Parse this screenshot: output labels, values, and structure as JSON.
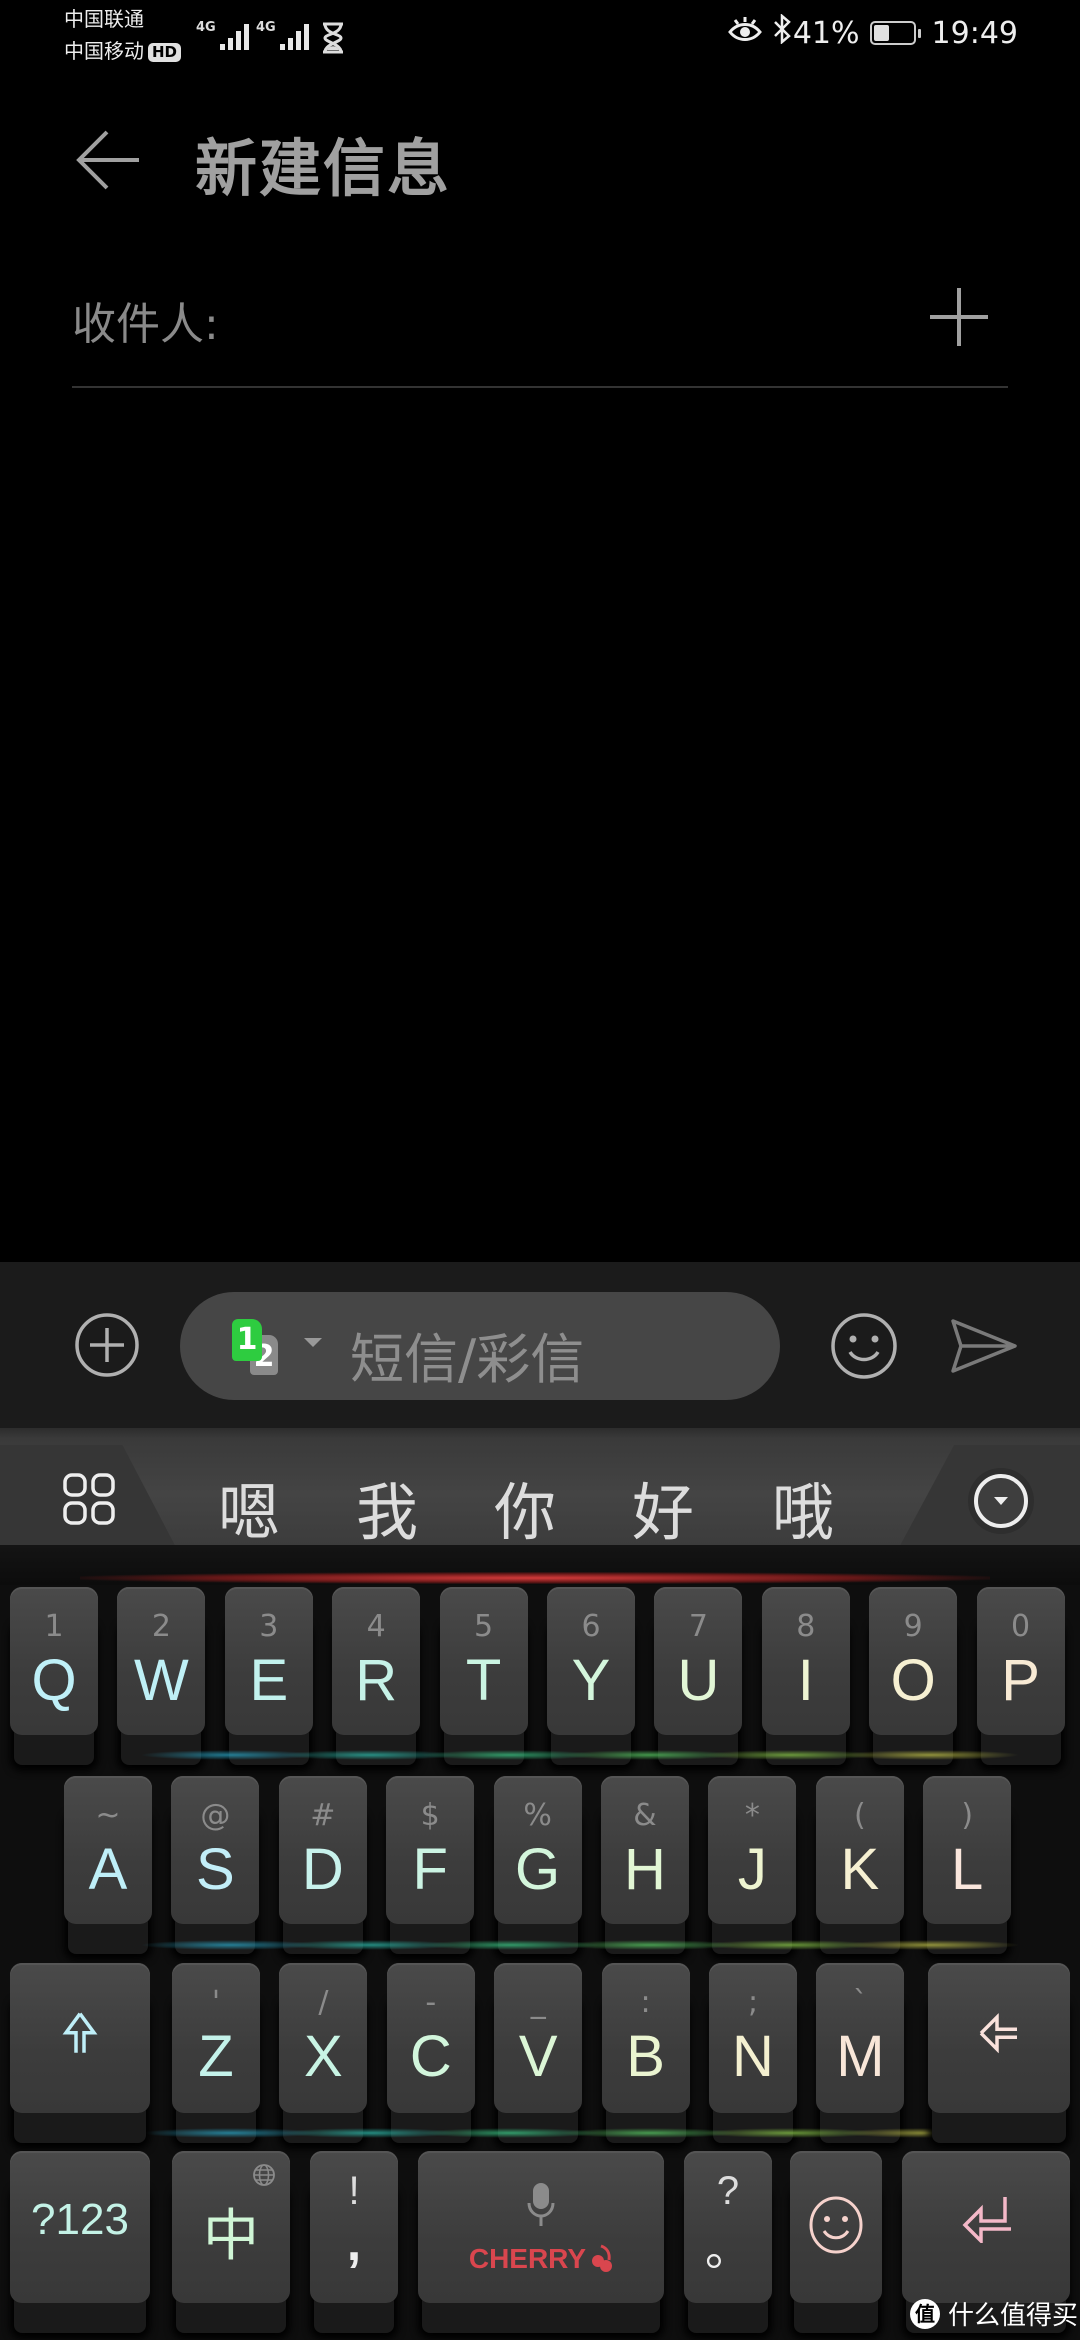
{
  "status_bar": {
    "carrier_1": "中国联通",
    "carrier_2": "中国移动",
    "hd_badge": "HD",
    "network_1": "4G",
    "network_2": "4G",
    "battery_percent": "41%",
    "battery_level": 0.41,
    "time": "19:49",
    "icons": [
      "signal-icon",
      "signal-icon",
      "hourglass-icon",
      "eye-comfort-icon",
      "bluetooth-icon",
      "battery-icon"
    ]
  },
  "header": {
    "back_icon": "arrow-left-icon",
    "title": "新建信息"
  },
  "recipient": {
    "label": "收件人:",
    "add_icon": "plus-icon"
  },
  "compose": {
    "attach_icon": "plus-circle-icon",
    "sim_card_1": "1",
    "sim_card_2": "2",
    "sim_color": "#2ecc40",
    "placeholder": "短信/彩信",
    "emoji_icon": "smiley-icon",
    "send_icon": "send-icon"
  },
  "keyboard": {
    "menu_icon": "grid-icon",
    "candidates": [
      "嗯",
      "我",
      "你",
      "好",
      "哦"
    ],
    "collapse_icon": "chevron-down-circle-icon",
    "row1": [
      {
        "main": "Q",
        "sub": "1",
        "color": "#bff0f8"
      },
      {
        "main": "W",
        "sub": "2",
        "color": "#bff0f6"
      },
      {
        "main": "E",
        "sub": "3",
        "color": "#c2f2ee"
      },
      {
        "main": "R",
        "sub": "4",
        "color": "#c6f2e8"
      },
      {
        "main": "T",
        "sub": "5",
        "color": "#caf4e2"
      },
      {
        "main": "Y",
        "sub": "6",
        "color": "#d4f6dc"
      },
      {
        "main": "U",
        "sub": "7",
        "color": "#e2f6d6"
      },
      {
        "main": "I",
        "sub": "8",
        "color": "#eef4d2"
      },
      {
        "main": "O",
        "sub": "9",
        "color": "#f6f0d2"
      },
      {
        "main": "P",
        "sub": "0",
        "color": "#f8ead4"
      }
    ],
    "row2": [
      {
        "main": "A",
        "sub": "~",
        "color": "#bfeff8"
      },
      {
        "main": "S",
        "sub": "@",
        "color": "#c2eef8"
      },
      {
        "main": "D",
        "sub": "#",
        "color": "#c8f2ec"
      },
      {
        "main": "F",
        "sub": "$",
        "color": "#ccf4e4"
      },
      {
        "main": "G",
        "sub": "%",
        "color": "#d4f6dc"
      },
      {
        "main": "H",
        "sub": "&",
        "color": "#e2f6d4"
      },
      {
        "main": "J",
        "sub": "*",
        "color": "#eef4d0"
      },
      {
        "main": "K",
        "sub": "(",
        "color": "#f6f0d2"
      },
      {
        "main": "L",
        "sub": ")",
        "color": "#fae6dc"
      }
    ],
    "row3": [
      {
        "main": "Z",
        "sub": "'",
        "color": "#c4f2ea"
      },
      {
        "main": "X",
        "sub": "/",
        "color": "#c8f4e4"
      },
      {
        "main": "C",
        "sub": "-",
        "color": "#d2f6dc"
      },
      {
        "main": "V",
        "sub": "_",
        "color": "#dcf6d6"
      },
      {
        "main": "B",
        "sub": ":",
        "color": "#eaf4d0"
      },
      {
        "main": "N",
        "sub": ";",
        "color": "#f4f0d0"
      },
      {
        "main": "M",
        "sub": "`",
        "color": "#f8e6d8"
      }
    ],
    "shift_icon": "shift-arrow-icon",
    "shift_color": "#bfeff8",
    "backspace_icon": "backspace-icon",
    "backspace_color": "#fae2dc",
    "row4": {
      "symbols_label": "?123",
      "symbols_color": "#c4f2e6",
      "lang_label": "中",
      "lang_color": "#d0f6d6",
      "globe_icon": "globe-icon",
      "punct1_top": "!",
      "punct1_bottom": ",",
      "mic_icon": "microphone-icon",
      "space_brand": "CHERRY",
      "brand_color": "#d9464e",
      "punct2_top": "?",
      "punct2_bottom": "。",
      "emoji_icon": "smiley-icon",
      "emoji_color": "#f6d2cc",
      "enter_icon": "enter-arrow-icon",
      "enter_color": "#f4b8c8"
    }
  },
  "watermark": {
    "badge": "值",
    "text": "什么值得买"
  }
}
